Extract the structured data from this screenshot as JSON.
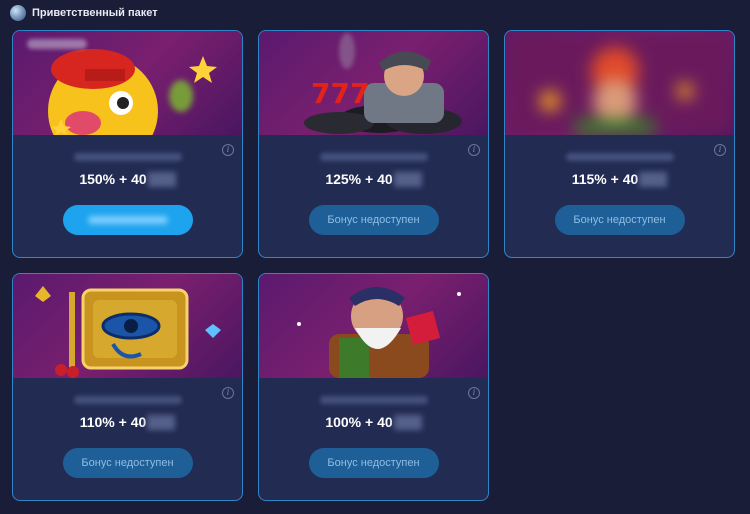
{
  "header": {
    "title": "Приветственный пакет",
    "icon": "welcome-package-icon"
  },
  "cards": [
    {
      "offer": "150% + 40",
      "button_label": "",
      "button_state": "active",
      "art": "yellow-duck-slot-art"
    },
    {
      "offer": "125% + 40",
      "button_label": "Бонус недоступен",
      "button_state": "disabled",
      "art": "old-man-tires-slot-art"
    },
    {
      "offer": "115% + 40",
      "button_label": "Бонус недоступен",
      "button_state": "disabled",
      "art": "blurred-slot-art"
    },
    {
      "offer": "110% + 40",
      "button_label": "Бонус недоступен",
      "button_state": "disabled",
      "art": "eye-of-horus-slot-art"
    },
    {
      "offer": "100% + 40",
      "button_label": "Бонус недоступен",
      "button_state": "disabled",
      "art": "dwarf-gems-slot-art"
    }
  ]
}
